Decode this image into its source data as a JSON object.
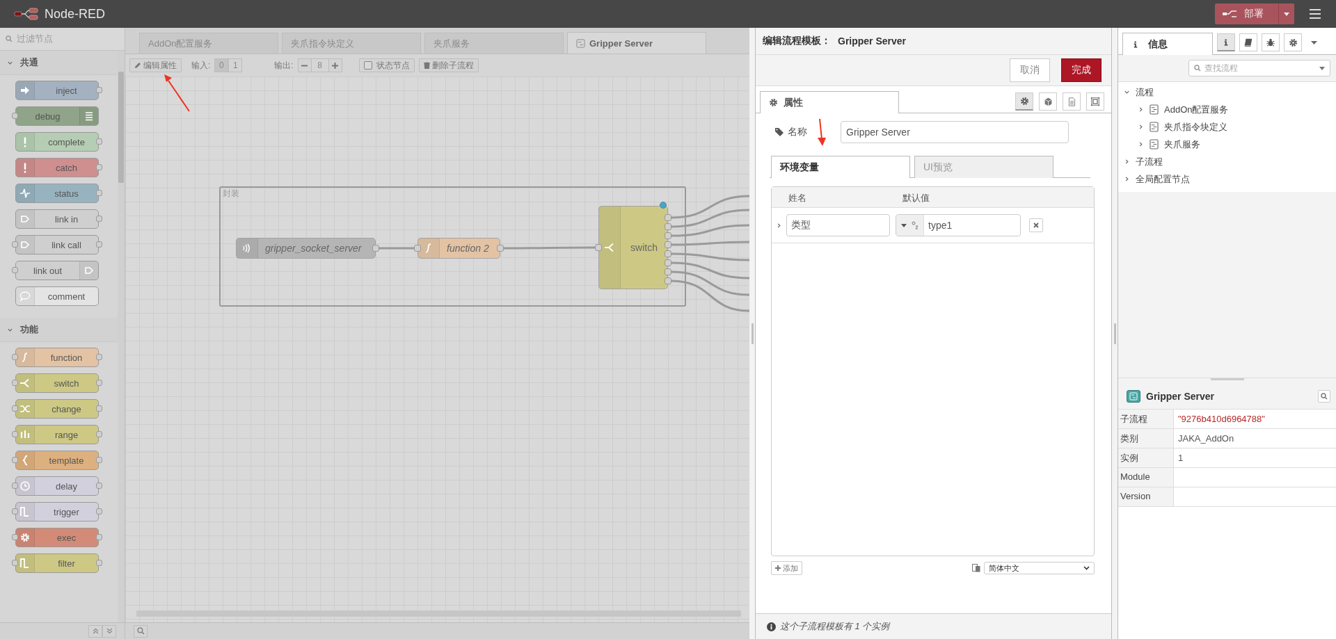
{
  "header": {
    "title": "Node-RED",
    "deploy": {
      "label": "部署"
    }
  },
  "palette": {
    "filter_placeholder": "过滤节点",
    "categories": [
      {
        "label": "共通",
        "expanded": true,
        "nodes": [
          {
            "label": "inject",
            "kind": "arrow",
            "color": "#a3b1c0",
            "input": false,
            "output": true,
            "icon_right": false
          },
          {
            "label": "debug",
            "kind": "lines",
            "color": "#8fa488",
            "input": true,
            "output": false,
            "icon_right": true
          },
          {
            "label": "complete",
            "kind": "exclamation",
            "color": "#b5ceb3",
            "input": false,
            "output": true,
            "icon_right": false
          },
          {
            "label": "catch",
            "kind": "exclamation",
            "color": "#cf8f8f",
            "input": false,
            "output": true,
            "icon_right": false
          },
          {
            "label": "status",
            "kind": "pulse",
            "color": "#97b3bf",
            "input": false,
            "output": true,
            "icon_right": false
          },
          {
            "label": "link in",
            "kind": "link",
            "color": "#cfcfcf",
            "input": false,
            "output": true,
            "icon_right": false
          },
          {
            "label": "link call",
            "kind": "link",
            "color": "#cfcfcf",
            "input": true,
            "output": true,
            "icon_right": false
          },
          {
            "label": "link out",
            "kind": "link",
            "color": "#cfcfcf",
            "input": true,
            "output": false,
            "icon_right": true
          },
          {
            "label": "comment",
            "kind": "bubble",
            "color": "#e4e4e4",
            "input": false,
            "output": false,
            "icon_right": false
          }
        ]
      },
      {
        "label": "功能",
        "expanded": true,
        "nodes": [
          {
            "label": "function",
            "kind": "curve",
            "color": "#e3c3a4",
            "input": true,
            "output": true,
            "icon_right": false
          },
          {
            "label": "switch",
            "kind": "fork",
            "color": "#cdc985",
            "input": true,
            "output": true,
            "icon_right": false
          },
          {
            "label": "change",
            "kind": "shuffle",
            "color": "#cdc985",
            "input": true,
            "output": true,
            "icon_right": false
          },
          {
            "label": "range",
            "kind": "range",
            "color": "#cdc985",
            "input": true,
            "output": true,
            "icon_right": false
          },
          {
            "label": "template",
            "kind": "brace",
            "color": "#ddb07f",
            "input": true,
            "output": true,
            "icon_right": false
          },
          {
            "label": "delay",
            "kind": "clock",
            "color": "#d3d0dd",
            "input": true,
            "output": true,
            "icon_right": false
          },
          {
            "label": "trigger",
            "kind": "wave",
            "color": "#d3d0dd",
            "input": true,
            "output": true,
            "icon_right": false
          },
          {
            "label": "exec",
            "kind": "gear",
            "color": "#d38b78",
            "input": true,
            "output": true,
            "icon_right": false
          },
          {
            "label": "filter",
            "kind": "wave",
            "color": "#cdc985",
            "input": true,
            "output": true,
            "icon_right": false
          }
        ]
      }
    ]
  },
  "workspace": {
    "tabs": [
      {
        "label": "AddOn配置服务",
        "kind": "flow",
        "selected": false
      },
      {
        "label": "夹爪指令块定义",
        "kind": "flow",
        "selected": false
      },
      {
        "label": "夹爪服务",
        "kind": "flow",
        "selected": false
      },
      {
        "label": "Gripper Server",
        "kind": "subflow",
        "selected": true
      }
    ],
    "toolbar": {
      "edit_button": "编辑属性",
      "inputs_label": "输入:",
      "inputs": [
        {
          "label": "0",
          "selected": true
        },
        {
          "label": "1",
          "selected": false
        }
      ],
      "outputs_label": "输出:",
      "outputs_value": "8",
      "status_node": {
        "label": "状态节点",
        "checked": false
      },
      "delete_button": "删除子流程"
    },
    "canvas": {
      "group": {
        "label": "封装"
      },
      "nodes": [
        {
          "label": "gripper_socket_server",
          "kind": "tcp",
          "color": "#b5b5b5",
          "italic": true,
          "changed": false
        },
        {
          "label": "function 2",
          "kind": "curve",
          "color": "#e3c3a4",
          "italic": true,
          "changed": false
        },
        {
          "label": "switch",
          "kind": "fork",
          "color": "#cdc985",
          "italic": false,
          "changed": true
        }
      ]
    }
  },
  "editor": {
    "title_prefix": "编辑流程模板：",
    "title_name": "Gripper Server",
    "cancel": "取消",
    "done": "完成",
    "tabs": [
      {
        "label": "属性",
        "selected": true
      }
    ],
    "tool_buttons": [
      {
        "kind": "settings",
        "selected": true
      },
      {
        "kind": "cube",
        "selected": false
      },
      {
        "kind": "document",
        "selected": false
      },
      {
        "kind": "frame",
        "selected": false
      }
    ],
    "name_label": "名称",
    "name_value": "Gripper Server",
    "subtabs": [
      {
        "label": "环境变量",
        "selected": true
      },
      {
        "label": "UI预览",
        "selected": false
      }
    ],
    "env_table": {
      "columns": [
        "姓名",
        "默认值"
      ],
      "rows": [
        {
          "name": "类型",
          "value": "type1",
          "expanded": false
        }
      ]
    },
    "add_button": "添加",
    "language": "简体中文",
    "footer": "这个子流程模板有 1 个实例"
  },
  "sidebar": {
    "tabs": [
      {
        "label": "信息",
        "selected": true
      }
    ],
    "tool_buttons": [
      {
        "kind": "info",
        "selected": true
      },
      {
        "kind": "book",
        "selected": false
      },
      {
        "kind": "bug",
        "selected": false
      },
      {
        "kind": "settings",
        "selected": false
      }
    ],
    "search_placeholder": "查找流程",
    "tree": [
      {
        "label": "流程",
        "expanded": true,
        "children": [
          {
            "label": "AddOn配置服务",
            "expanded": false
          },
          {
            "label": "夹爪指令块定义",
            "expanded": false
          },
          {
            "label": "夹爪服务",
            "expanded": false
          }
        ]
      },
      {
        "label": "子流程",
        "expanded": false
      },
      {
        "label": "全局配置节点",
        "expanded": false
      }
    ],
    "info": {
      "title": "Gripper Server",
      "rows": [
        {
          "label": "子流程",
          "value": "\"9276b410d6964788\"",
          "kind": "string"
        },
        {
          "label": "类别",
          "value": "JAKA_AddOn",
          "kind": "text"
        },
        {
          "label": "实例",
          "value": "1",
          "kind": "text"
        },
        {
          "label": "Module",
          "kind": "text"
        },
        {
          "label": "Version",
          "kind": "text"
        }
      ]
    }
  }
}
